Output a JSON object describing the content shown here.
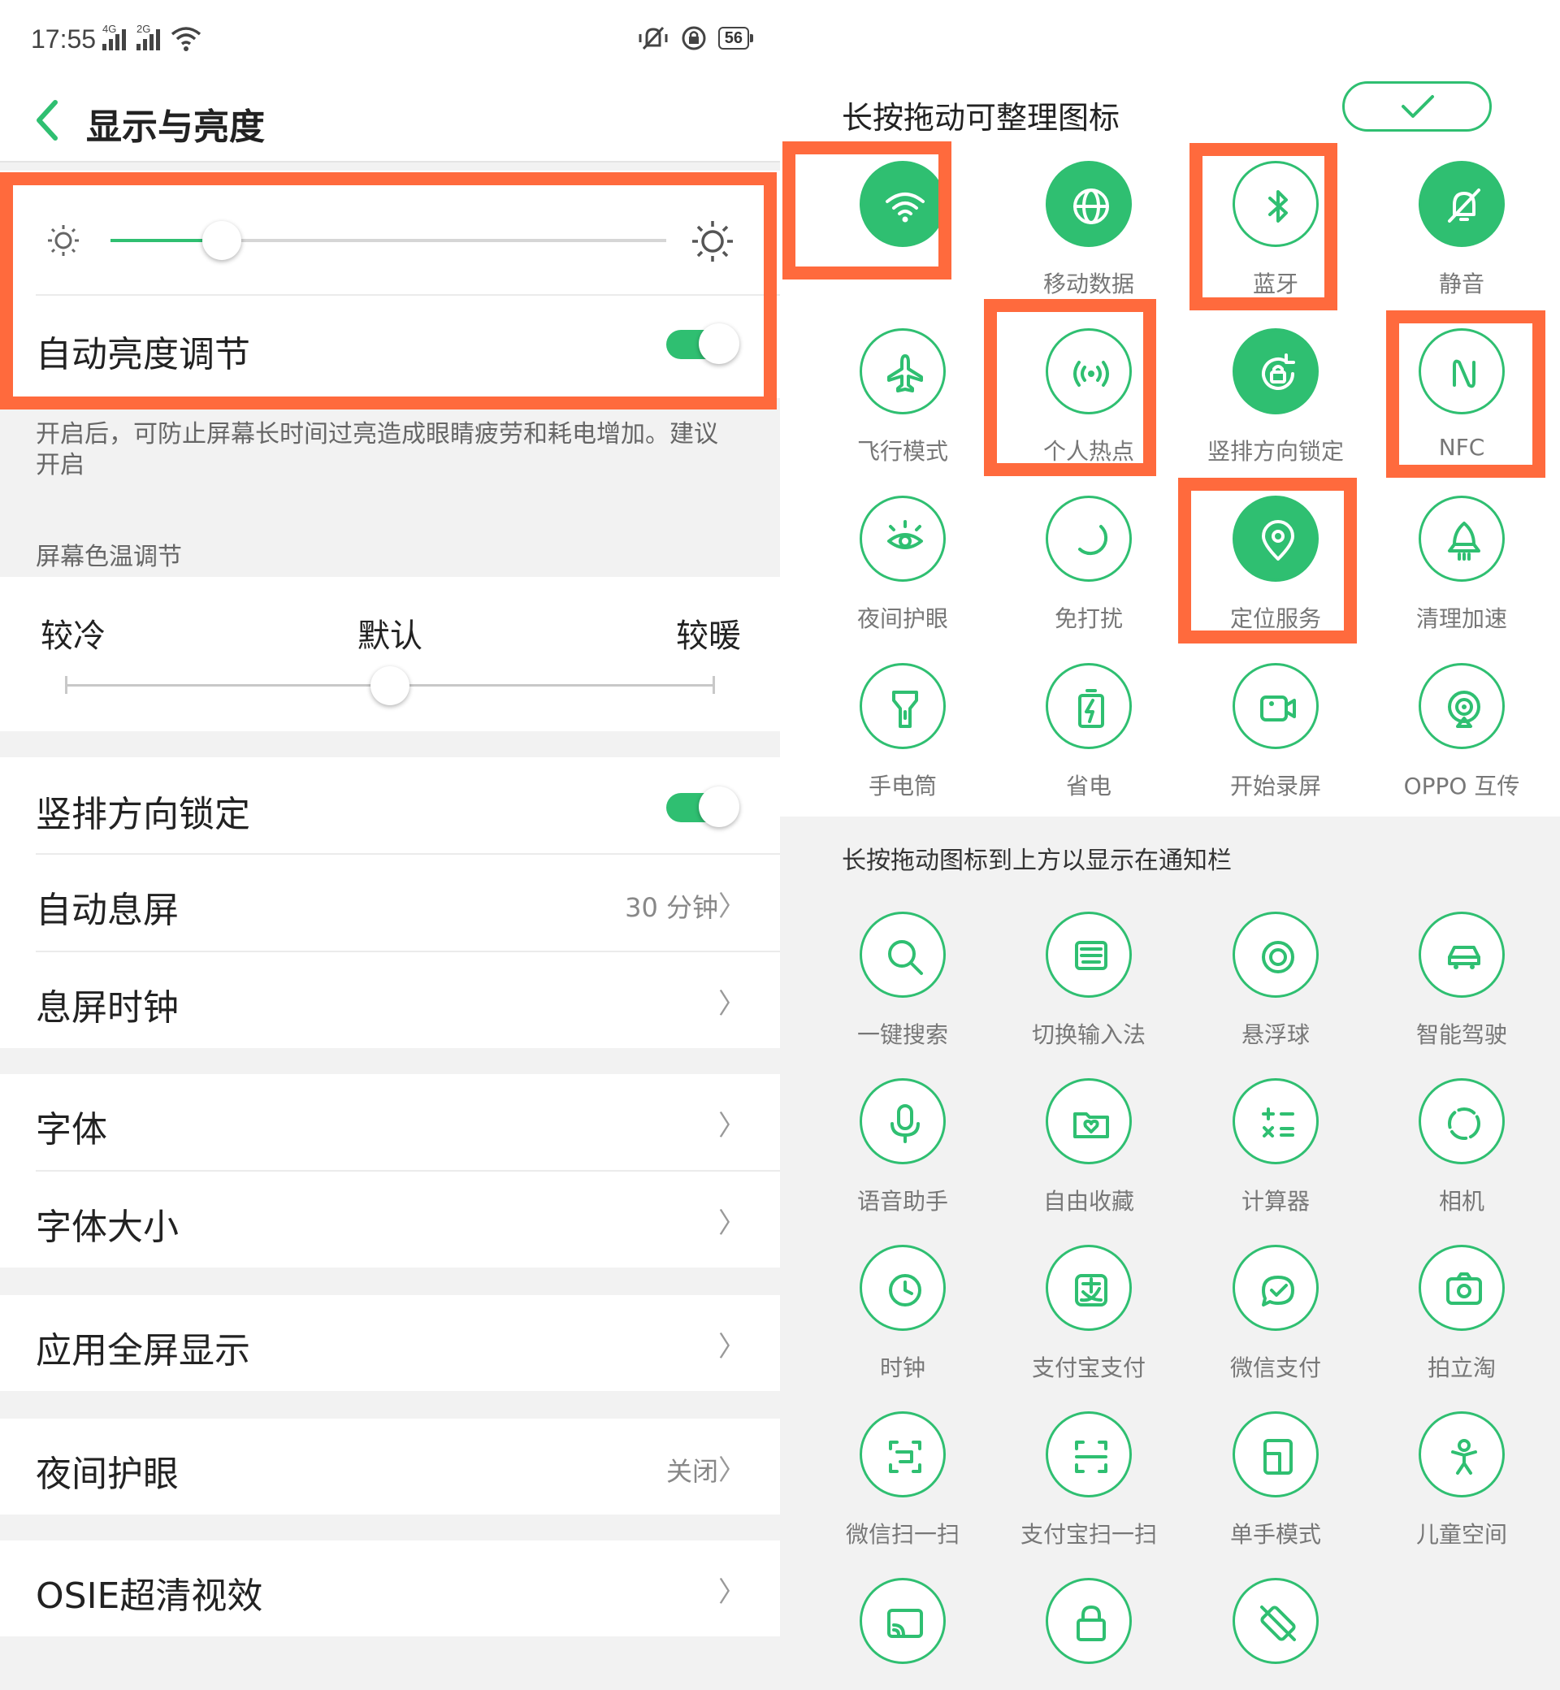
{
  "colors": {
    "accent": "#2fbf71",
    "highlight": "#ff6a3d",
    "text": "#222222",
    "secondary": "#888888"
  },
  "status_bar": {
    "time": "17:55",
    "network_1": "4G",
    "network_2": "2G",
    "battery": "56"
  },
  "header": {
    "title": "显示与亮度"
  },
  "brightness": {
    "level": 0.2,
    "auto_label": "自动亮度调节",
    "auto_on": true
  },
  "brightness_desc": "开启后，可防止屏幕长时间过亮造成眼睛疲劳和耗电增加。建议开启",
  "color_temp": {
    "section_label": "屏幕色温调节",
    "cool": "较冷",
    "default": "默认",
    "warm": "较暖",
    "level": 0.5
  },
  "settings": {
    "portrait_lock": "竖排方向锁定",
    "auto_sleep": "自动息屏",
    "auto_sleep_value": "30 分钟",
    "sleep_clock": "息屏时钟",
    "font": "字体",
    "font_size": "字体大小",
    "app_fullscreen": "应用全屏显示",
    "night_mode": "夜间护眼",
    "night_mode_value": "关闭",
    "osie": "OSIE超清视效"
  },
  "chevron": "〉",
  "quick_panel": {
    "title": "长按拖动可整理图标",
    "subtitle": "长按拖动图标到上方以显示在通知栏",
    "active_tiles": [
      {
        "label": "",
        "icon": "wifi-icon",
        "on": true
      },
      {
        "label": "移动数据",
        "icon": "globe-icon",
        "on": true
      },
      {
        "label": "蓝牙",
        "icon": "bluetooth-icon",
        "on": false
      },
      {
        "label": "静音",
        "icon": "bell-off-icon",
        "on": true
      },
      {
        "label": "飞行模式",
        "icon": "airplane-icon",
        "on": false
      },
      {
        "label": "个人热点",
        "icon": "hotspot-icon",
        "on": false
      },
      {
        "label": "竖排方向锁定",
        "icon": "rotation-lock-icon",
        "on": true
      },
      {
        "label": "NFC",
        "icon": "nfc-icon",
        "on": false
      },
      {
        "label": "夜间护眼",
        "icon": "eye-icon",
        "on": false
      },
      {
        "label": "免打扰",
        "icon": "moon-icon",
        "on": false
      },
      {
        "label": "定位服务",
        "icon": "location-icon",
        "on": true
      },
      {
        "label": "清理加速",
        "icon": "rocket-icon",
        "on": false
      },
      {
        "label": "手电筒",
        "icon": "flashlight-icon",
        "on": false
      },
      {
        "label": "省电",
        "icon": "battery-saver-icon",
        "on": false
      },
      {
        "label": "开始录屏",
        "icon": "screen-record-icon",
        "on": false
      },
      {
        "label": "OPPO 互传",
        "icon": "share-icon",
        "on": false
      }
    ],
    "inactive_tiles": [
      {
        "label": "一键搜索",
        "icon": "search-icon"
      },
      {
        "label": "切换输入法",
        "icon": "keyboard-icon"
      },
      {
        "label": "悬浮球",
        "icon": "float-ball-icon"
      },
      {
        "label": "智能驾驶",
        "icon": "car-icon"
      },
      {
        "label": "语音助手",
        "icon": "mic-icon"
      },
      {
        "label": "自由收藏",
        "icon": "folder-heart-icon"
      },
      {
        "label": "计算器",
        "icon": "calculator-icon"
      },
      {
        "label": "相机",
        "icon": "camera-aperture-icon"
      },
      {
        "label": "时钟",
        "icon": "clock-icon"
      },
      {
        "label": "支付宝支付",
        "icon": "alipay-icon"
      },
      {
        "label": "微信支付",
        "icon": "wechat-pay-icon"
      },
      {
        "label": "拍立淘",
        "icon": "photo-search-icon"
      },
      {
        "label": "微信扫一扫",
        "icon": "wechat-scan-icon"
      },
      {
        "label": "支付宝扫一扫",
        "icon": "alipay-scan-icon"
      },
      {
        "label": "单手模式",
        "icon": "one-hand-icon"
      },
      {
        "label": "儿童空间",
        "icon": "child-icon"
      },
      {
        "label": "",
        "icon": "cast-icon"
      },
      {
        "label": "",
        "icon": "lock-icon"
      },
      {
        "label": "",
        "icon": "no-rotate-icon"
      }
    ]
  }
}
